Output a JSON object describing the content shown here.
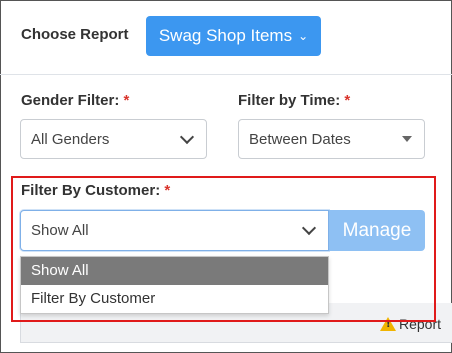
{
  "header": {
    "choose_label": "Choose Report",
    "report_button": "Swag Shop Items"
  },
  "filters": {
    "gender": {
      "label": "Gender Filter:",
      "required": "*",
      "value": "All Genders"
    },
    "time": {
      "label": "Filter by Time:",
      "required": "*",
      "value": "Between Dates"
    }
  },
  "customer_filter": {
    "label": "Filter By Customer:",
    "required": "*",
    "value": "Show All",
    "manage_button": "Manage",
    "options": [
      {
        "label": "Show All",
        "selected": true
      },
      {
        "label": "Filter By Customer",
        "selected": false
      }
    ]
  },
  "footer": {
    "warning_text": "Report"
  },
  "colors": {
    "accent": "#3c97f0",
    "highlight": "#e01a1a",
    "required": "#d9342b"
  }
}
